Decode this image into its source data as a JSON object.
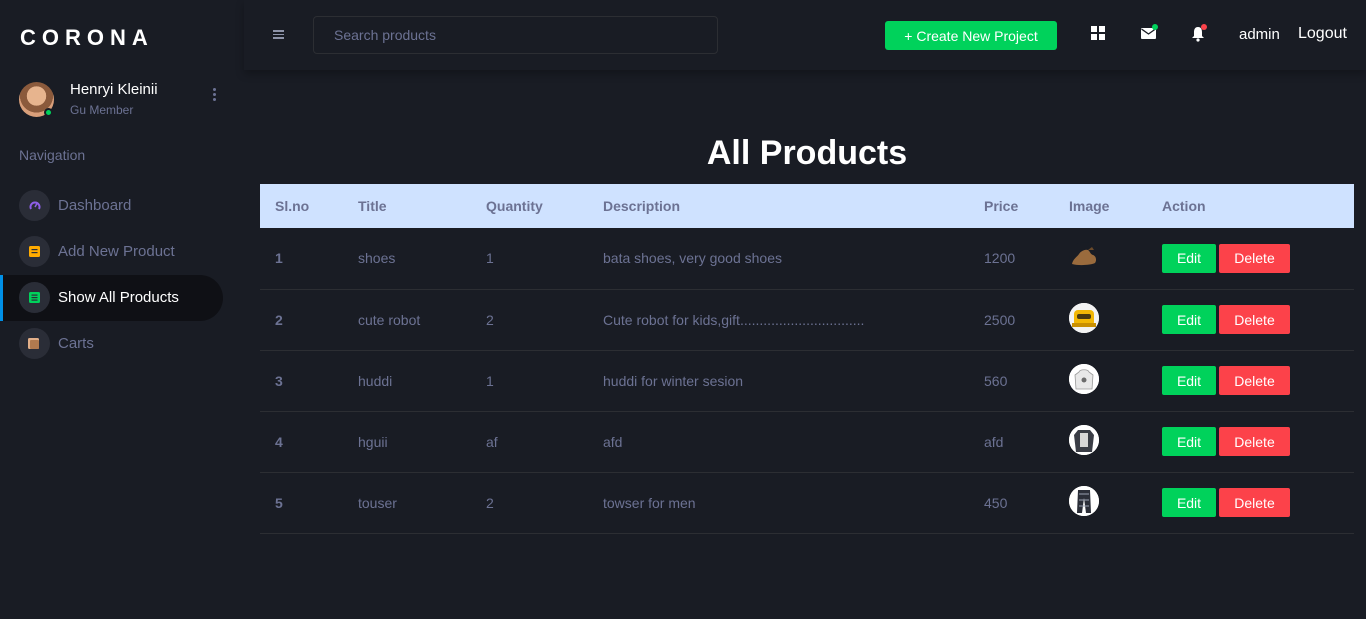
{
  "brand": "CORONA",
  "profile": {
    "name": "Henryi Kleinii",
    "role": "Gu Member"
  },
  "nav": {
    "heading": "Navigation",
    "items": [
      {
        "label": "Dashboard",
        "icon": "speedometer-icon",
        "color": "#8f5fe8"
      },
      {
        "label": "Add New Product",
        "icon": "note-icon",
        "color": "#ffab00"
      },
      {
        "label": "Show All Products",
        "icon": "list-icon",
        "color": "#00d25b",
        "active": true
      },
      {
        "label": "Carts",
        "icon": "cart-icon",
        "color": "#e3b08a"
      }
    ]
  },
  "topbar": {
    "search_placeholder": "Search products",
    "create_label": "+ Create New Project",
    "user": "admin",
    "logout": "Logout"
  },
  "main": {
    "title": "All Products",
    "columns": [
      "Sl.no",
      "Title",
      "Quantity",
      "Description",
      "Price",
      "Image",
      "Action"
    ],
    "rows": [
      {
        "slno": "1",
        "title": "shoes",
        "quantity": "1",
        "description": "bata shoes, very good shoes",
        "price": "1200",
        "image": "shoe"
      },
      {
        "slno": "2",
        "title": "cute robot",
        "quantity": "2",
        "description": "Cute robot for kids,gift................................",
        "price": "2500",
        "image": "robot"
      },
      {
        "slno": "3",
        "title": "huddi",
        "quantity": "1",
        "description": "huddi for winter sesion",
        "price": "560",
        "image": "hoodie"
      },
      {
        "slno": "4",
        "title": "hguii",
        "quantity": "af",
        "description": "afd",
        "price": "afd",
        "image": "shirt"
      },
      {
        "slno": "5",
        "title": "touser",
        "quantity": "2",
        "description": "towser for men",
        "price": "450",
        "image": "trousers"
      }
    ],
    "edit_label": "Edit",
    "delete_label": "Delete"
  },
  "colors": {
    "success": "#00d25b",
    "danger": "#fc424a",
    "primary": "#0090e7",
    "header_bg": "#cfe2ff",
    "body_bg": "#191c24"
  }
}
